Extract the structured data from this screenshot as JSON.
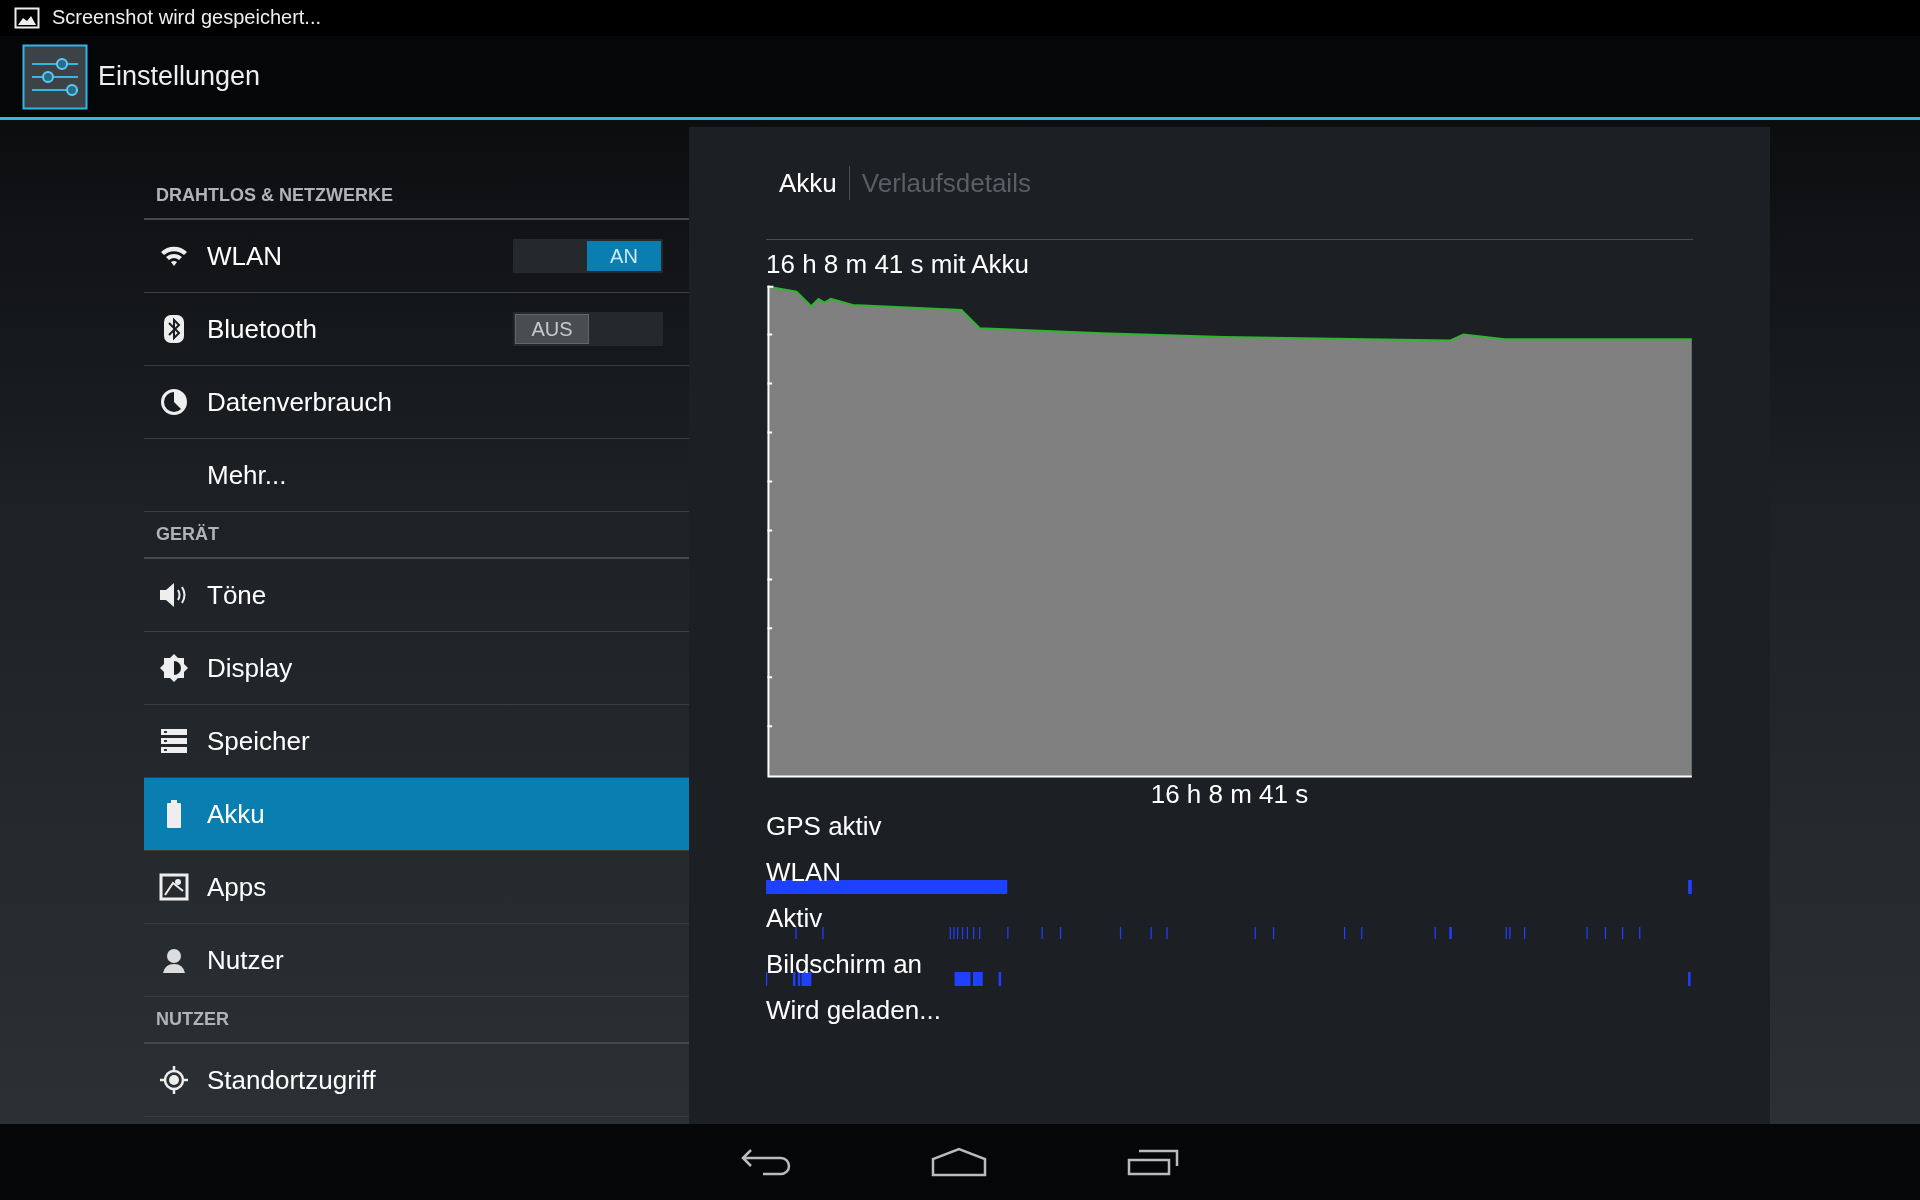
{
  "status_bar": {
    "notification": "Screenshot wird gespeichert..."
  },
  "action_bar": {
    "title": "Einstellungen"
  },
  "sidebar": {
    "sections": [
      {
        "header": "DRAHTLOS & NETZWERKE",
        "items": [
          {
            "label": "WLAN",
            "selected": false,
            "kind": "toggle",
            "toggle": {
              "label": "AN",
              "on": true
            }
          },
          {
            "label": "Bluetooth",
            "selected": false,
            "kind": "toggle",
            "toggle": {
              "label": "AUS",
              "on": false
            }
          },
          {
            "label": "Datenverbrauch",
            "selected": false,
            "kind": "plain"
          },
          {
            "label": "Mehr...",
            "selected": false,
            "kind": "plain"
          }
        ]
      },
      {
        "header": "GERÄT",
        "items": [
          {
            "label": "Töne",
            "selected": false,
            "kind": "plain"
          },
          {
            "label": "Display",
            "selected": false,
            "kind": "plain"
          },
          {
            "label": "Speicher",
            "selected": false,
            "kind": "plain"
          },
          {
            "label": "Akku",
            "selected": true,
            "kind": "plain"
          },
          {
            "label": "Apps",
            "selected": false,
            "kind": "plain"
          },
          {
            "label": "Nutzer",
            "selected": false,
            "kind": "plain"
          }
        ]
      },
      {
        "header": "NUTZER",
        "items": [
          {
            "label": "Standortzugriff",
            "selected": false,
            "kind": "plain"
          }
        ]
      }
    ]
  },
  "detail": {
    "tabs": [
      {
        "label": "Akku",
        "selected": true
      },
      {
        "label": "Verlaufsdetails",
        "selected": false
      }
    ],
    "summary": "16 h 8 m 41 s mit Akku",
    "duration": "16 h 8 m 41 s",
    "signals": [
      {
        "label": "GPS aktiv"
      },
      {
        "label": "WLAN"
      },
      {
        "label": "Aktiv"
      },
      {
        "label": "Bildschirm an"
      },
      {
        "label": "Wird geladen..."
      }
    ]
  }
}
